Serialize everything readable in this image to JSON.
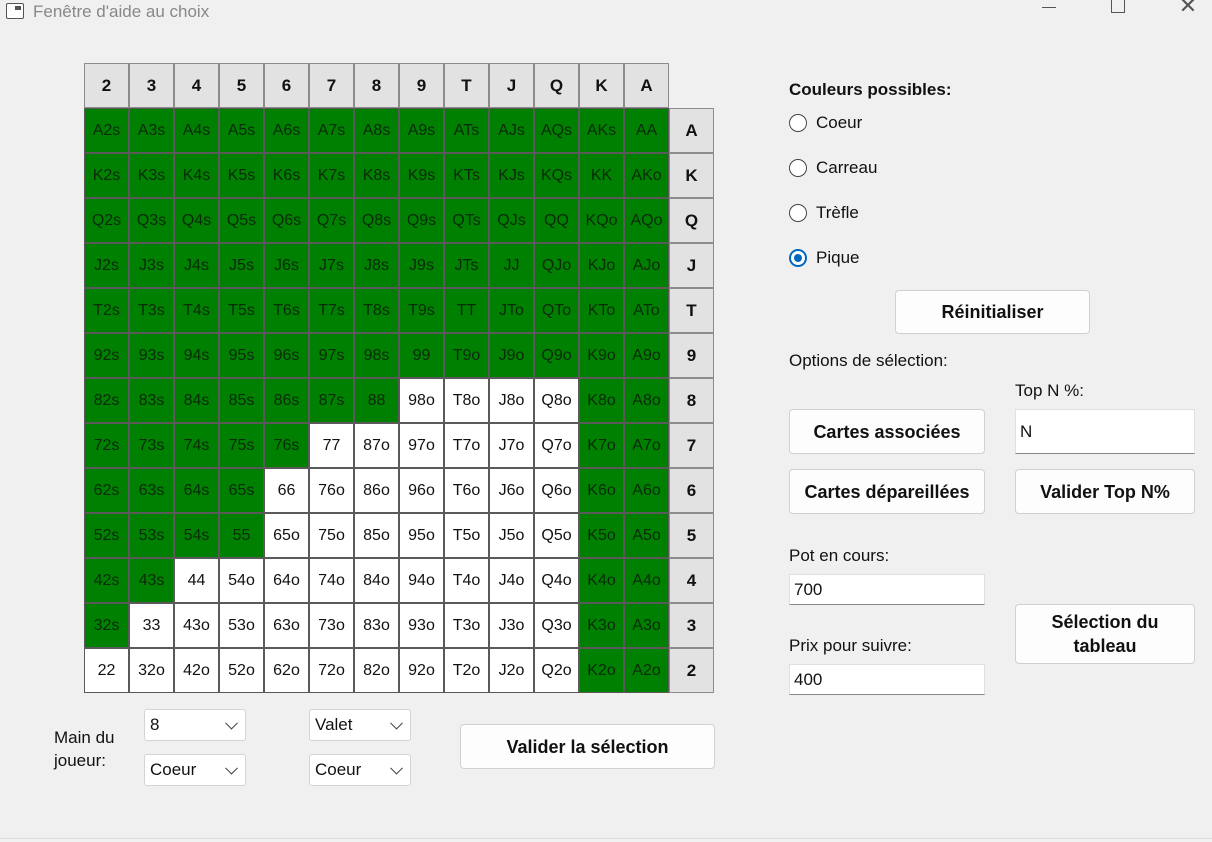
{
  "window": {
    "title": "Fenêtre d'aide au choix",
    "icon": "app-window-icon",
    "controls": [
      "minimize-icon",
      "maximize-icon",
      "close-icon"
    ],
    "close_glyph": "✕"
  },
  "grid": {
    "col_headers": [
      "2",
      "3",
      "4",
      "5",
      "6",
      "7",
      "8",
      "9",
      "T",
      "J",
      "Q",
      "K",
      "A"
    ],
    "row_headers": [
      "A",
      "K",
      "Q",
      "J",
      "T",
      "9",
      "8",
      "7",
      "6",
      "5",
      "4",
      "3",
      "2"
    ],
    "selected_color": "#008000",
    "unselected_color": "#ffffff",
    "rows": [
      {
        "cells": [
          "A2s",
          "A3s",
          "A4s",
          "A5s",
          "A6s",
          "A7s",
          "A8s",
          "A9s",
          "ATs",
          "AJs",
          "AQs",
          "AKs",
          "AA"
        ],
        "selected": [
          1,
          1,
          1,
          1,
          1,
          1,
          1,
          1,
          1,
          1,
          1,
          1,
          1
        ]
      },
      {
        "cells": [
          "K2s",
          "K3s",
          "K4s",
          "K5s",
          "K6s",
          "K7s",
          "K8s",
          "K9s",
          "KTs",
          "KJs",
          "KQs",
          "KK",
          "AKo"
        ],
        "selected": [
          1,
          1,
          1,
          1,
          1,
          1,
          1,
          1,
          1,
          1,
          1,
          1,
          1
        ]
      },
      {
        "cells": [
          "Q2s",
          "Q3s",
          "Q4s",
          "Q5s",
          "Q6s",
          "Q7s",
          "Q8s",
          "Q9s",
          "QTs",
          "QJs",
          "QQ",
          "KQo",
          "AQo"
        ],
        "selected": [
          1,
          1,
          1,
          1,
          1,
          1,
          1,
          1,
          1,
          1,
          1,
          1,
          1
        ]
      },
      {
        "cells": [
          "J2s",
          "J3s",
          "J4s",
          "J5s",
          "J6s",
          "J7s",
          "J8s",
          "J9s",
          "JTs",
          "JJ",
          "QJo",
          "KJo",
          "AJo"
        ],
        "selected": [
          1,
          1,
          1,
          1,
          1,
          1,
          1,
          1,
          1,
          1,
          1,
          1,
          1
        ]
      },
      {
        "cells": [
          "T2s",
          "T3s",
          "T4s",
          "T5s",
          "T6s",
          "T7s",
          "T8s",
          "T9s",
          "TT",
          "JTo",
          "QTo",
          "KTo",
          "ATo"
        ],
        "selected": [
          1,
          1,
          1,
          1,
          1,
          1,
          1,
          1,
          1,
          1,
          1,
          1,
          1
        ]
      },
      {
        "cells": [
          "92s",
          "93s",
          "94s",
          "95s",
          "96s",
          "97s",
          "98s",
          "99",
          "T9o",
          "J9o",
          "Q9o",
          "K9o",
          "A9o"
        ],
        "selected": [
          1,
          1,
          1,
          1,
          1,
          1,
          1,
          1,
          1,
          1,
          1,
          1,
          1
        ]
      },
      {
        "cells": [
          "82s",
          "83s",
          "84s",
          "85s",
          "86s",
          "87s",
          "88",
          "98o",
          "T8o",
          "J8o",
          "Q8o",
          "K8o",
          "A8o"
        ],
        "selected": [
          1,
          1,
          1,
          1,
          1,
          1,
          1,
          0,
          0,
          0,
          0,
          1,
          1
        ]
      },
      {
        "cells": [
          "72s",
          "73s",
          "74s",
          "75s",
          "76s",
          "77",
          "87o",
          "97o",
          "T7o",
          "J7o",
          "Q7o",
          "K7o",
          "A7o"
        ],
        "selected": [
          1,
          1,
          1,
          1,
          1,
          0,
          0,
          0,
          0,
          0,
          0,
          1,
          1
        ]
      },
      {
        "cells": [
          "62s",
          "63s",
          "64s",
          "65s",
          "66",
          "76o",
          "86o",
          "96o",
          "T6o",
          "J6o",
          "Q6o",
          "K6o",
          "A6o"
        ],
        "selected": [
          1,
          1,
          1,
          1,
          0,
          0,
          0,
          0,
          0,
          0,
          0,
          1,
          1
        ]
      },
      {
        "cells": [
          "52s",
          "53s",
          "54s",
          "55",
          "65o",
          "75o",
          "85o",
          "95o",
          "T5o",
          "J5o",
          "Q5o",
          "K5o",
          "A5o"
        ],
        "selected": [
          1,
          1,
          1,
          1,
          0,
          0,
          0,
          0,
          0,
          0,
          0,
          1,
          1
        ]
      },
      {
        "cells": [
          "42s",
          "43s",
          "44",
          "54o",
          "64o",
          "74o",
          "84o",
          "94o",
          "T4o",
          "J4o",
          "Q4o",
          "K4o",
          "A4o"
        ],
        "selected": [
          1,
          1,
          0,
          0,
          0,
          0,
          0,
          0,
          0,
          0,
          0,
          1,
          1
        ]
      },
      {
        "cells": [
          "32s",
          "33",
          "43o",
          "53o",
          "63o",
          "73o",
          "83o",
          "93o",
          "T3o",
          "J3o",
          "Q3o",
          "K3o",
          "A3o"
        ],
        "selected": [
          1,
          0,
          0,
          0,
          0,
          0,
          0,
          0,
          0,
          0,
          0,
          1,
          1
        ]
      },
      {
        "cells": [
          "22",
          "32o",
          "42o",
          "52o",
          "62o",
          "72o",
          "82o",
          "92o",
          "T2o",
          "J2o",
          "Q2o",
          "K2o",
          "A2o"
        ],
        "selected": [
          0,
          0,
          0,
          0,
          0,
          0,
          0,
          0,
          0,
          0,
          0,
          1,
          1
        ]
      }
    ]
  },
  "colors_panel": {
    "heading": "Couleurs possibles:",
    "options": [
      {
        "label": "Coeur",
        "checked": false
      },
      {
        "label": "Carreau",
        "checked": false
      },
      {
        "label": "Trèfle",
        "checked": false
      },
      {
        "label": "Pique",
        "checked": true
      }
    ],
    "accent": "#0067c0"
  },
  "buttons": {
    "reset": "Réinitialiser",
    "paired": "Cartes associées",
    "unpaired": "Cartes dépareillées",
    "validate_top": "Valider Top N%",
    "table_select_line1": "Sélection du",
    "table_select_line2": "tableau",
    "validate_selection": "Valider la sélection"
  },
  "options": {
    "heading": "Options de sélection:",
    "top_n_label": "Top N %:",
    "top_n_value": "N"
  },
  "pot": {
    "label": "Pot en cours:",
    "value": "700"
  },
  "call_price": {
    "label": "Prix pour suivre:",
    "value": "400"
  },
  "player_hand": {
    "label_line1": "Main du",
    "label_line2": "joueur:",
    "card1_rank": "8",
    "card1_suit": "Coeur",
    "card2_rank": "Valet",
    "card2_suit": "Coeur"
  }
}
